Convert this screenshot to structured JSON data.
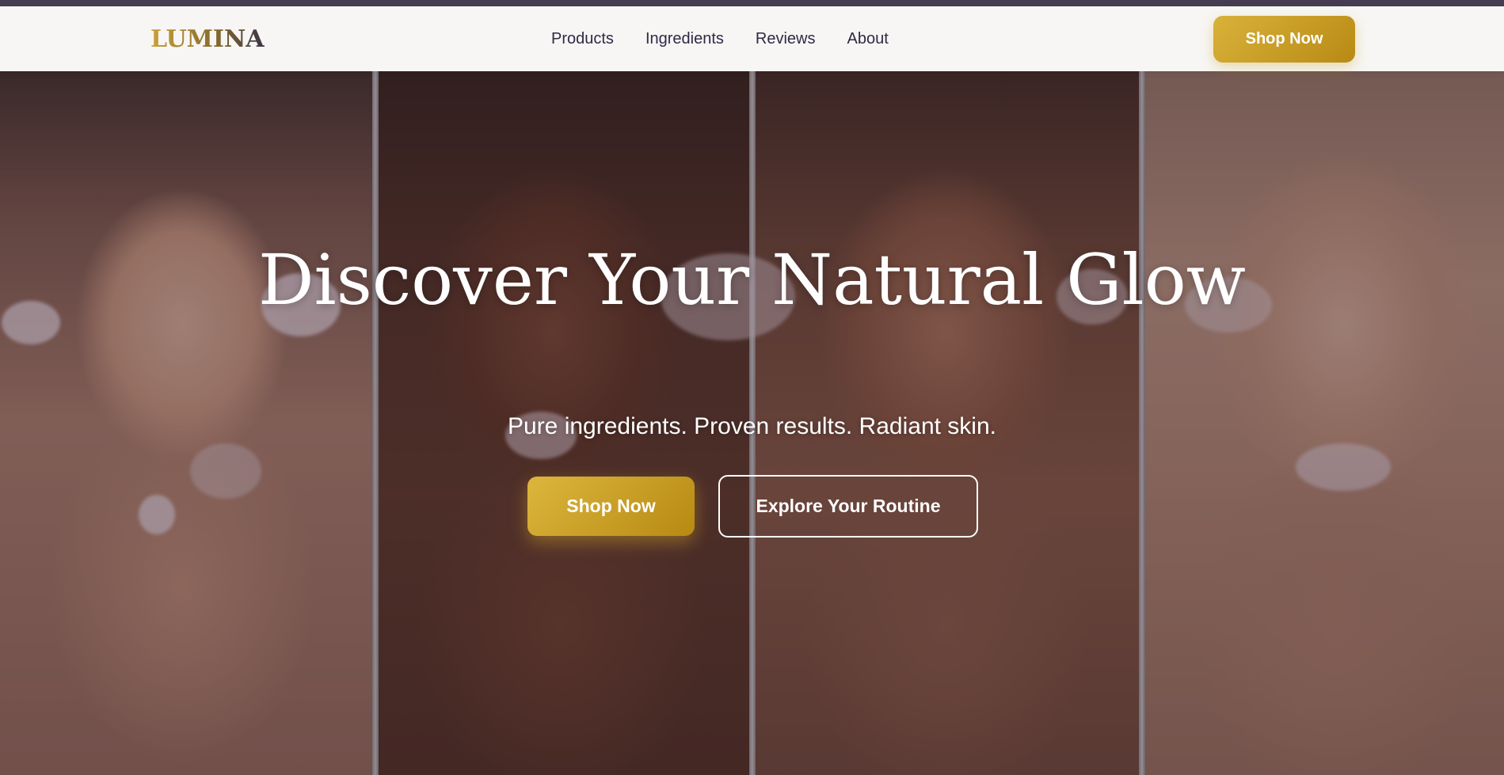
{
  "brand": {
    "logo_text": "LUMINA"
  },
  "nav": {
    "links": [
      {
        "label": "Products"
      },
      {
        "label": "Ingredients"
      },
      {
        "label": "Reviews"
      },
      {
        "label": "About"
      }
    ],
    "cta_label": "Shop Now"
  },
  "hero": {
    "title": "Discover Your Natural Glow",
    "subtitle": "Pure ingredients. Proven results. Radiant skin.",
    "primary_cta": "Shop Now",
    "secondary_cta": "Explore Your Routine"
  },
  "colors": {
    "accent_gold": "#c9a028",
    "nav_text": "#2e2a45",
    "top_strip": "#463d52"
  }
}
